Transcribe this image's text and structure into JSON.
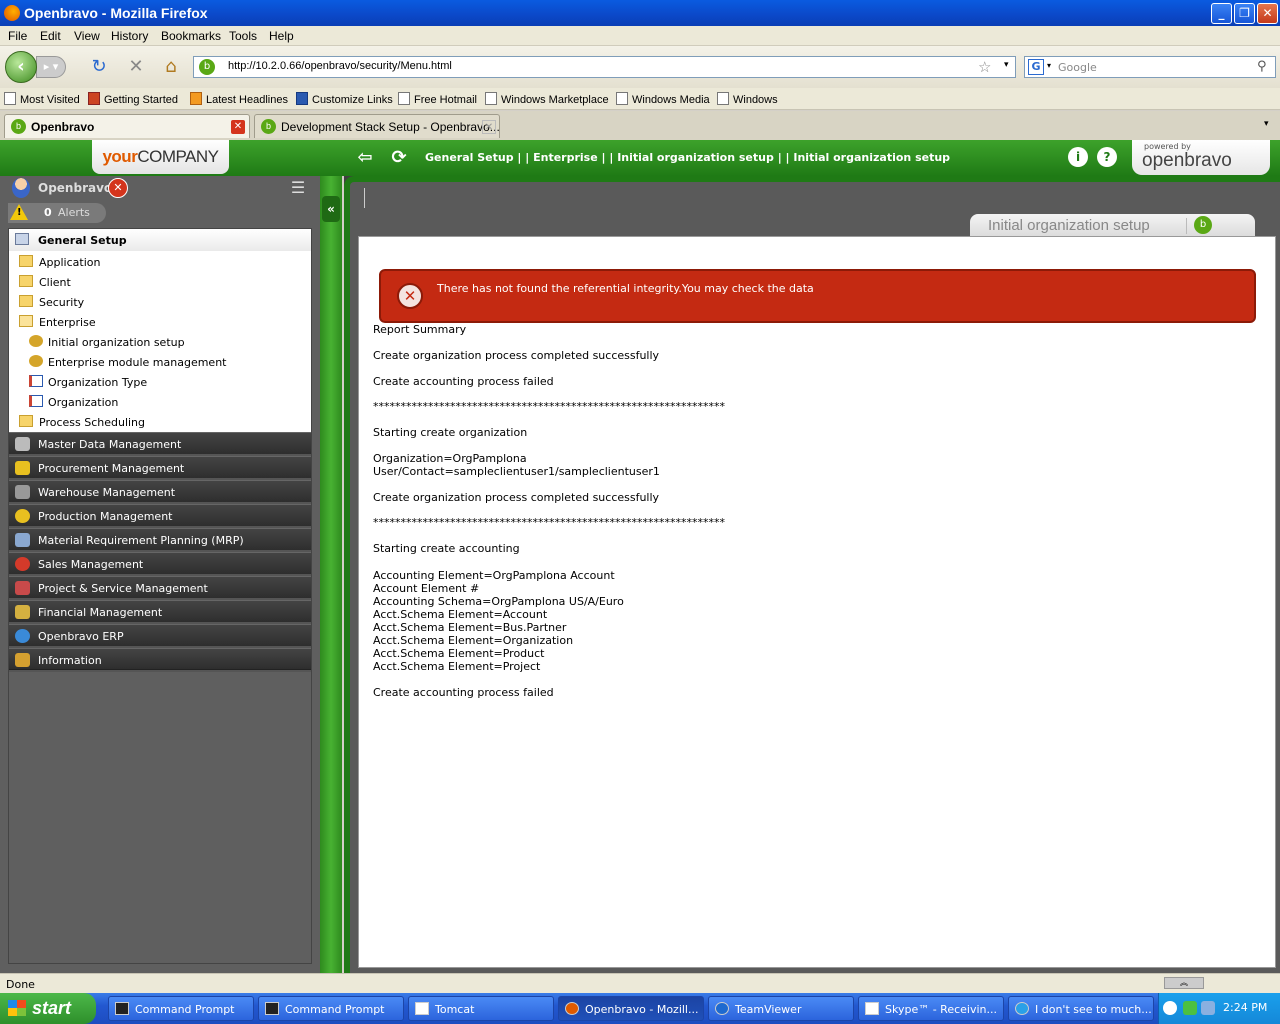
{
  "window": {
    "title": "Openbravo - Mozilla Firefox"
  },
  "menubar": [
    "File",
    "Edit",
    "View",
    "History",
    "Bookmarks",
    "Tools",
    "Help"
  ],
  "address": {
    "url": "http://10.2.0.66/openbravo/security/Menu.html",
    "search_placeholder": "Google"
  },
  "bookmarks": [
    "Most Visited",
    "Getting Started",
    "Latest Headlines",
    "Customize Links",
    "Free Hotmail",
    "Windows Marketplace",
    "Windows Media",
    "Windows"
  ],
  "tabs": [
    {
      "label": "Openbravo",
      "active": true
    },
    {
      "label": "Development Stack Setup - Openbravo...",
      "active": false
    }
  ],
  "app_header": {
    "logo_your": "your",
    "logo_company": "COMPANY",
    "breadcrumb": "General Setup  | |  Enterprise  | |  Initial organization setup   | |   Initial organization setup",
    "powered_by": "powered by",
    "powered_brand": "openbravo"
  },
  "sidebar": {
    "user": "Openbravo",
    "alerts_count": "0",
    "alerts_label": "Alerts",
    "open_section": "General Setup",
    "open_items": [
      {
        "label": "Application",
        "type": "folder"
      },
      {
        "label": "Client",
        "type": "folder"
      },
      {
        "label": "Security",
        "type": "folder"
      },
      {
        "label": "Enterprise",
        "type": "folder"
      },
      {
        "label": "Initial organization setup",
        "type": "process"
      },
      {
        "label": "Enterprise module management",
        "type": "process"
      },
      {
        "label": "Organization Type",
        "type": "window"
      },
      {
        "label": "Organization",
        "type": "window"
      },
      {
        "label": "Process Scheduling",
        "type": "folder"
      }
    ],
    "sections": [
      "Master Data Management",
      "Procurement Management",
      "Warehouse Management",
      "Production Management",
      "Material Requirement Planning (MRP)",
      "Sales Management",
      "Project & Service Management",
      "Financial Management",
      "Openbravo ERP",
      "Information"
    ]
  },
  "window_tab": {
    "title": "Initial organization setup"
  },
  "error": {
    "message": "There has not found the referential integrity.You may check the data"
  },
  "report": {
    "lines": [
      "Report Summary",
      "",
      "Create organization process completed successfully",
      "",
      "Create accounting process failed",
      "",
      "****************************************************************",
      "",
      "Starting create organization",
      "",
      "Organization=OrgPamplona",
      "User/Contact=sampleclientuser1/sampleclientuser1",
      "",
      "Create organization process completed successfully",
      "",
      "****************************************************************",
      "",
      "Starting create accounting",
      "",
      "Accounting Element=OrgPamplona Account",
      "Account Element #",
      "Accounting Schema=OrgPamplona US/A/Euro",
      "Acct.Schema Element=Account",
      "Acct.Schema Element=Bus.Partner",
      "Acct.Schema Element=Organization",
      "Acct.Schema Element=Product",
      "Acct.Schema Element=Project",
      "",
      "Create accounting process failed"
    ]
  },
  "statusbar": {
    "text": "Done"
  },
  "taskbar": {
    "start": "start",
    "tasks": [
      "Command Prompt",
      "Command Prompt",
      "Tomcat",
      "Openbravo - Mozill...",
      "TeamViewer",
      "Skype™ - Receivin...",
      "I don't see to much..."
    ],
    "clock": "2:24 PM"
  }
}
